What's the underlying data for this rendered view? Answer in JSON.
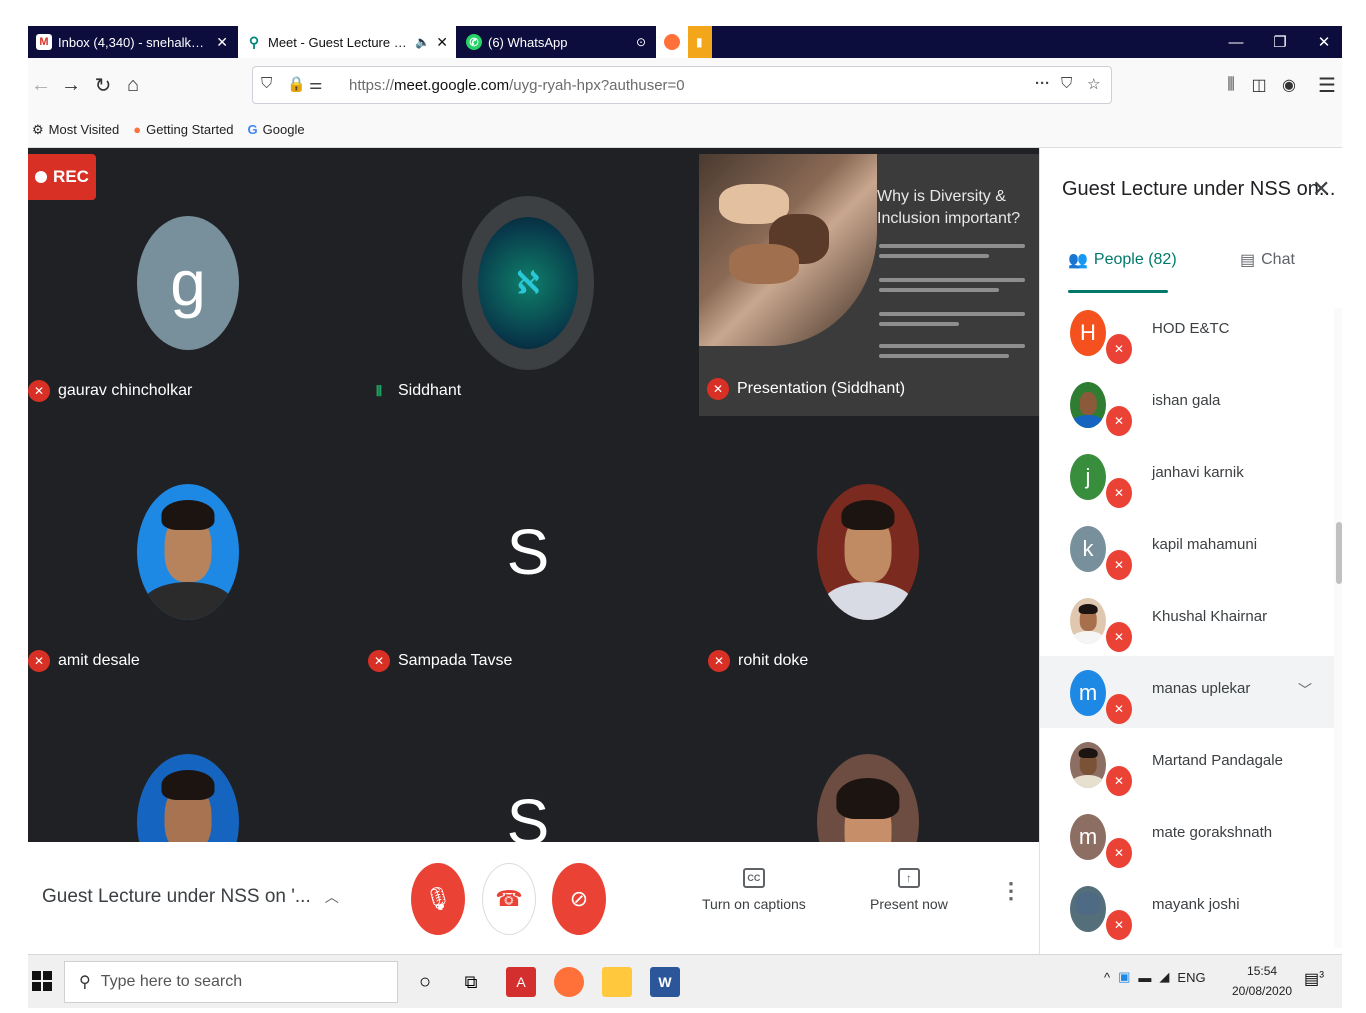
{
  "browser": {
    "tabs": [
      {
        "title": "Inbox (4,340) - snehalkoparde"
      },
      {
        "title": "Meet - Guest Lecture under"
      },
      {
        "title": "(6) WhatsApp"
      }
    ],
    "url_prefix": "https://",
    "url_domain": "meet.google.com",
    "url_path": "/uyg-ryah-hpx?authuser=0",
    "bookmarks": [
      "Most Visited",
      "Getting Started",
      "Google"
    ]
  },
  "meet": {
    "rec_label": "REC",
    "tiles": [
      {
        "name": "gaurav chincholkar",
        "initial": "g",
        "color": "#78909c"
      },
      {
        "name": "Siddhant"
      },
      {
        "name": "amit desale"
      },
      {
        "name": "Sampada Tavse",
        "initial": "S",
        "color": "#1565c0"
      },
      {
        "name": "rohit doke"
      },
      {
        "initial": "S",
        "color": "#6d4c41"
      }
    ],
    "presentation": {
      "slide_title": "Why is Diversity & Inclusion important?",
      "label": "Presentation (Siddhant)"
    },
    "bottom": {
      "meeting_title": "Guest Lecture under NSS on '...",
      "captions_label": "Turn on captions",
      "present_label": "Present now",
      "captions_icon": "CC"
    }
  },
  "panel": {
    "title": "Guest Lecture under NSS on...",
    "people_tab": "People (82)",
    "chat_tab": "Chat",
    "people": [
      {
        "name": "HOD E&TC",
        "initial": "H",
        "color": "#f4511e"
      },
      {
        "name": "ishan gala",
        "color": "#2e7d32"
      },
      {
        "name": "janhavi karnik",
        "initial": "j",
        "color": "#388e3c"
      },
      {
        "name": "kapil mahamuni",
        "initial": "k",
        "color": "#78909c"
      },
      {
        "name": "Khushal Khairnar",
        "color": "#e0c8b0"
      },
      {
        "name": "manas uplekar",
        "initial": "m",
        "color": "#1e88e5"
      },
      {
        "name": "Martand Pandagale",
        "color": "#8d6e63"
      },
      {
        "name": "mate gorakshnath",
        "initial": "m",
        "color": "#8d6e63"
      },
      {
        "name": "mayank joshi",
        "color": "#546e7a"
      }
    ]
  },
  "taskbar": {
    "search_placeholder": "Type here to search",
    "lang": "ENG",
    "time": "15:54",
    "date": "20/08/2020",
    "notifications": "3"
  }
}
